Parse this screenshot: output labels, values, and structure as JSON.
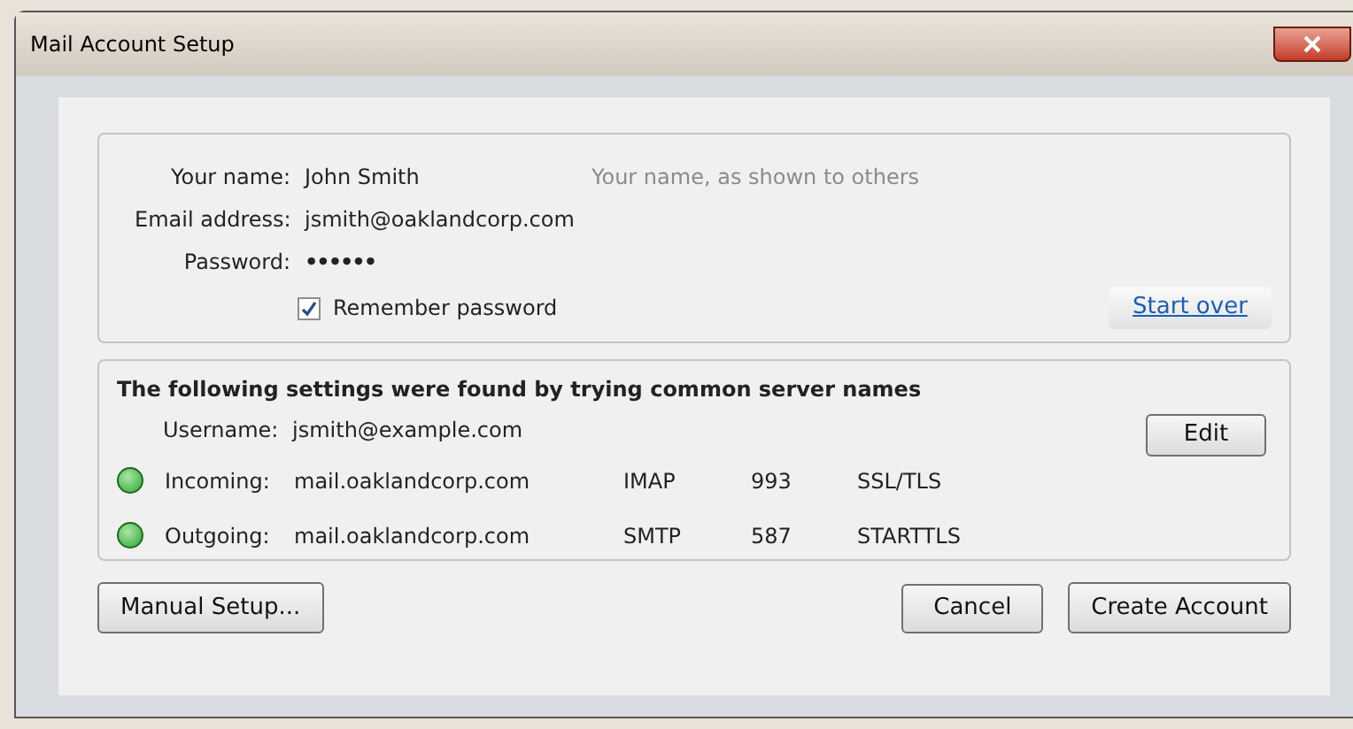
{
  "window": {
    "title": "Mail Account Setup"
  },
  "account": {
    "fields": [
      {
        "label": "Your name:",
        "value": "John Smith",
        "hint": "Your name, as shown to others",
        "kind": "text"
      },
      {
        "label": "Email address:",
        "value": "jsmith@oaklandcorp.com",
        "kind": "text"
      },
      {
        "label": "Password:",
        "value": "••••••",
        "kind": "password"
      }
    ],
    "remember": {
      "label": "Remember password",
      "checked": true
    },
    "start_over": "Start over"
  },
  "found": {
    "heading": "The following settings were found by trying common server names",
    "username": {
      "label": "Username:",
      "value": "jsmith@example.com"
    },
    "edit": "Edit",
    "servers": [
      {
        "label": "Incoming:",
        "host": "mail.oaklandcorp.com",
        "protocol": "IMAP",
        "port": "993",
        "security": "SSL/TLS",
        "ok": true
      },
      {
        "label": "Outgoing:",
        "host": "mail.oaklandcorp.com",
        "protocol": "SMTP",
        "port": "587",
        "security": "STARTTLS",
        "ok": true
      }
    ]
  },
  "buttons": {
    "manual": "Manual Setup...",
    "cancel": "Cancel",
    "create": "Create Account"
  }
}
